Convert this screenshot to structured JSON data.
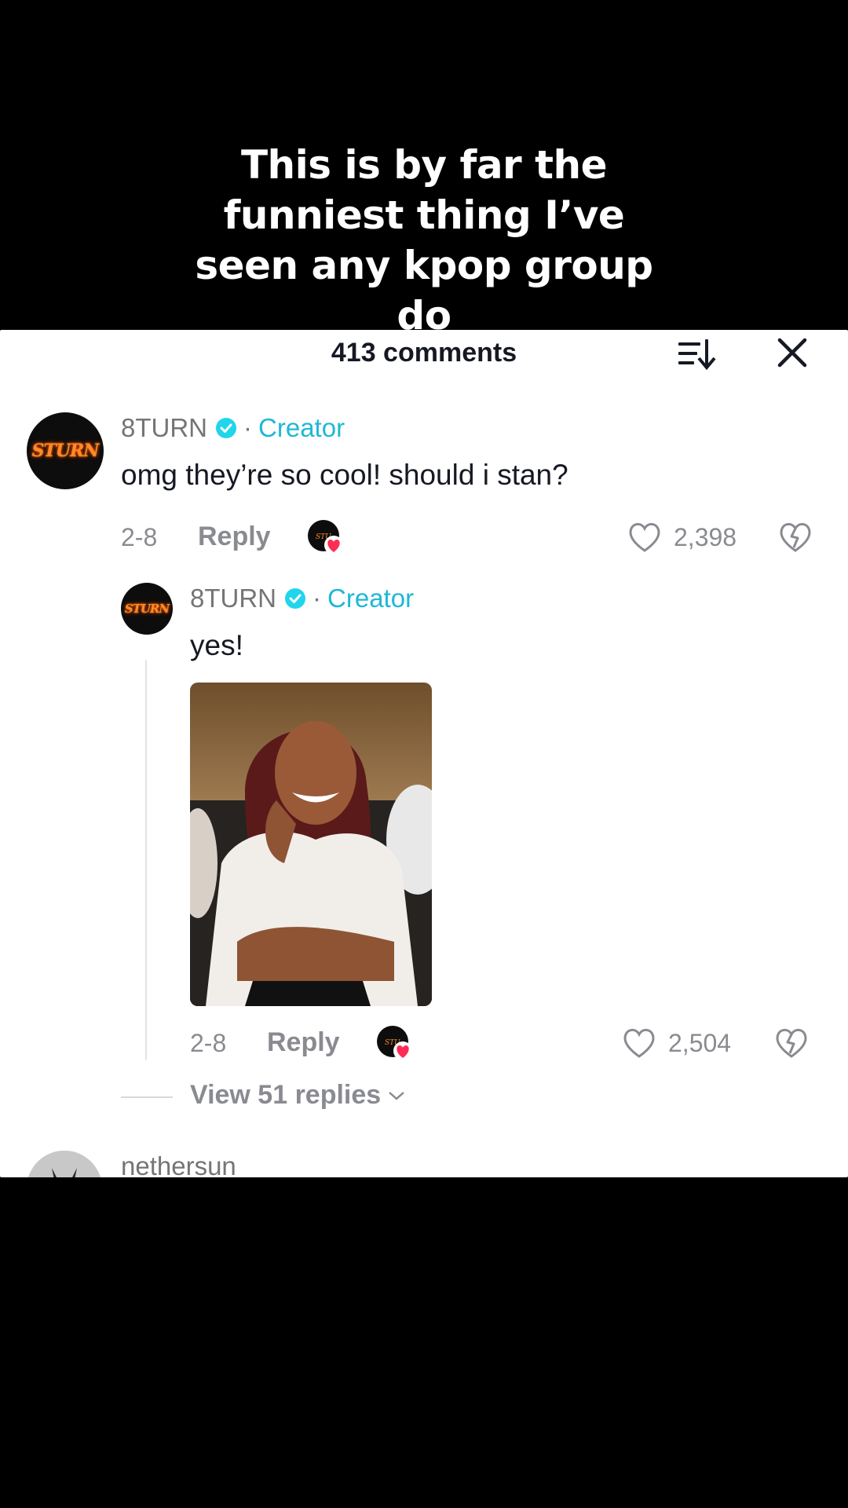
{
  "caption": "This is by far the funniest thing I’ve seen any kpop group do",
  "header": {
    "comments_count": "413 comments",
    "sort_icon": "sort-icon",
    "close_icon": "close-icon"
  },
  "comments": [
    {
      "avatar_text": "STURN",
      "username": "8TURN",
      "creator_label": "Creator",
      "text": "omg they’re so cool! should i stan?",
      "date": "2-8",
      "reply_label": "Reply",
      "likes": "2,398"
    }
  ],
  "reply": {
    "avatar_text": "STURN",
    "username": "8TURN",
    "creator_label": "Creator",
    "text": "yes!",
    "date": "2-8",
    "reply_label": "Reply",
    "likes": "2,504"
  },
  "view_replies": "View 51 replies",
  "next_comment": {
    "username": "nethersun"
  },
  "colors": {
    "creator": "#1fb8d6",
    "heart_badge": "#fe2c55",
    "verified": "#20d5ec"
  }
}
